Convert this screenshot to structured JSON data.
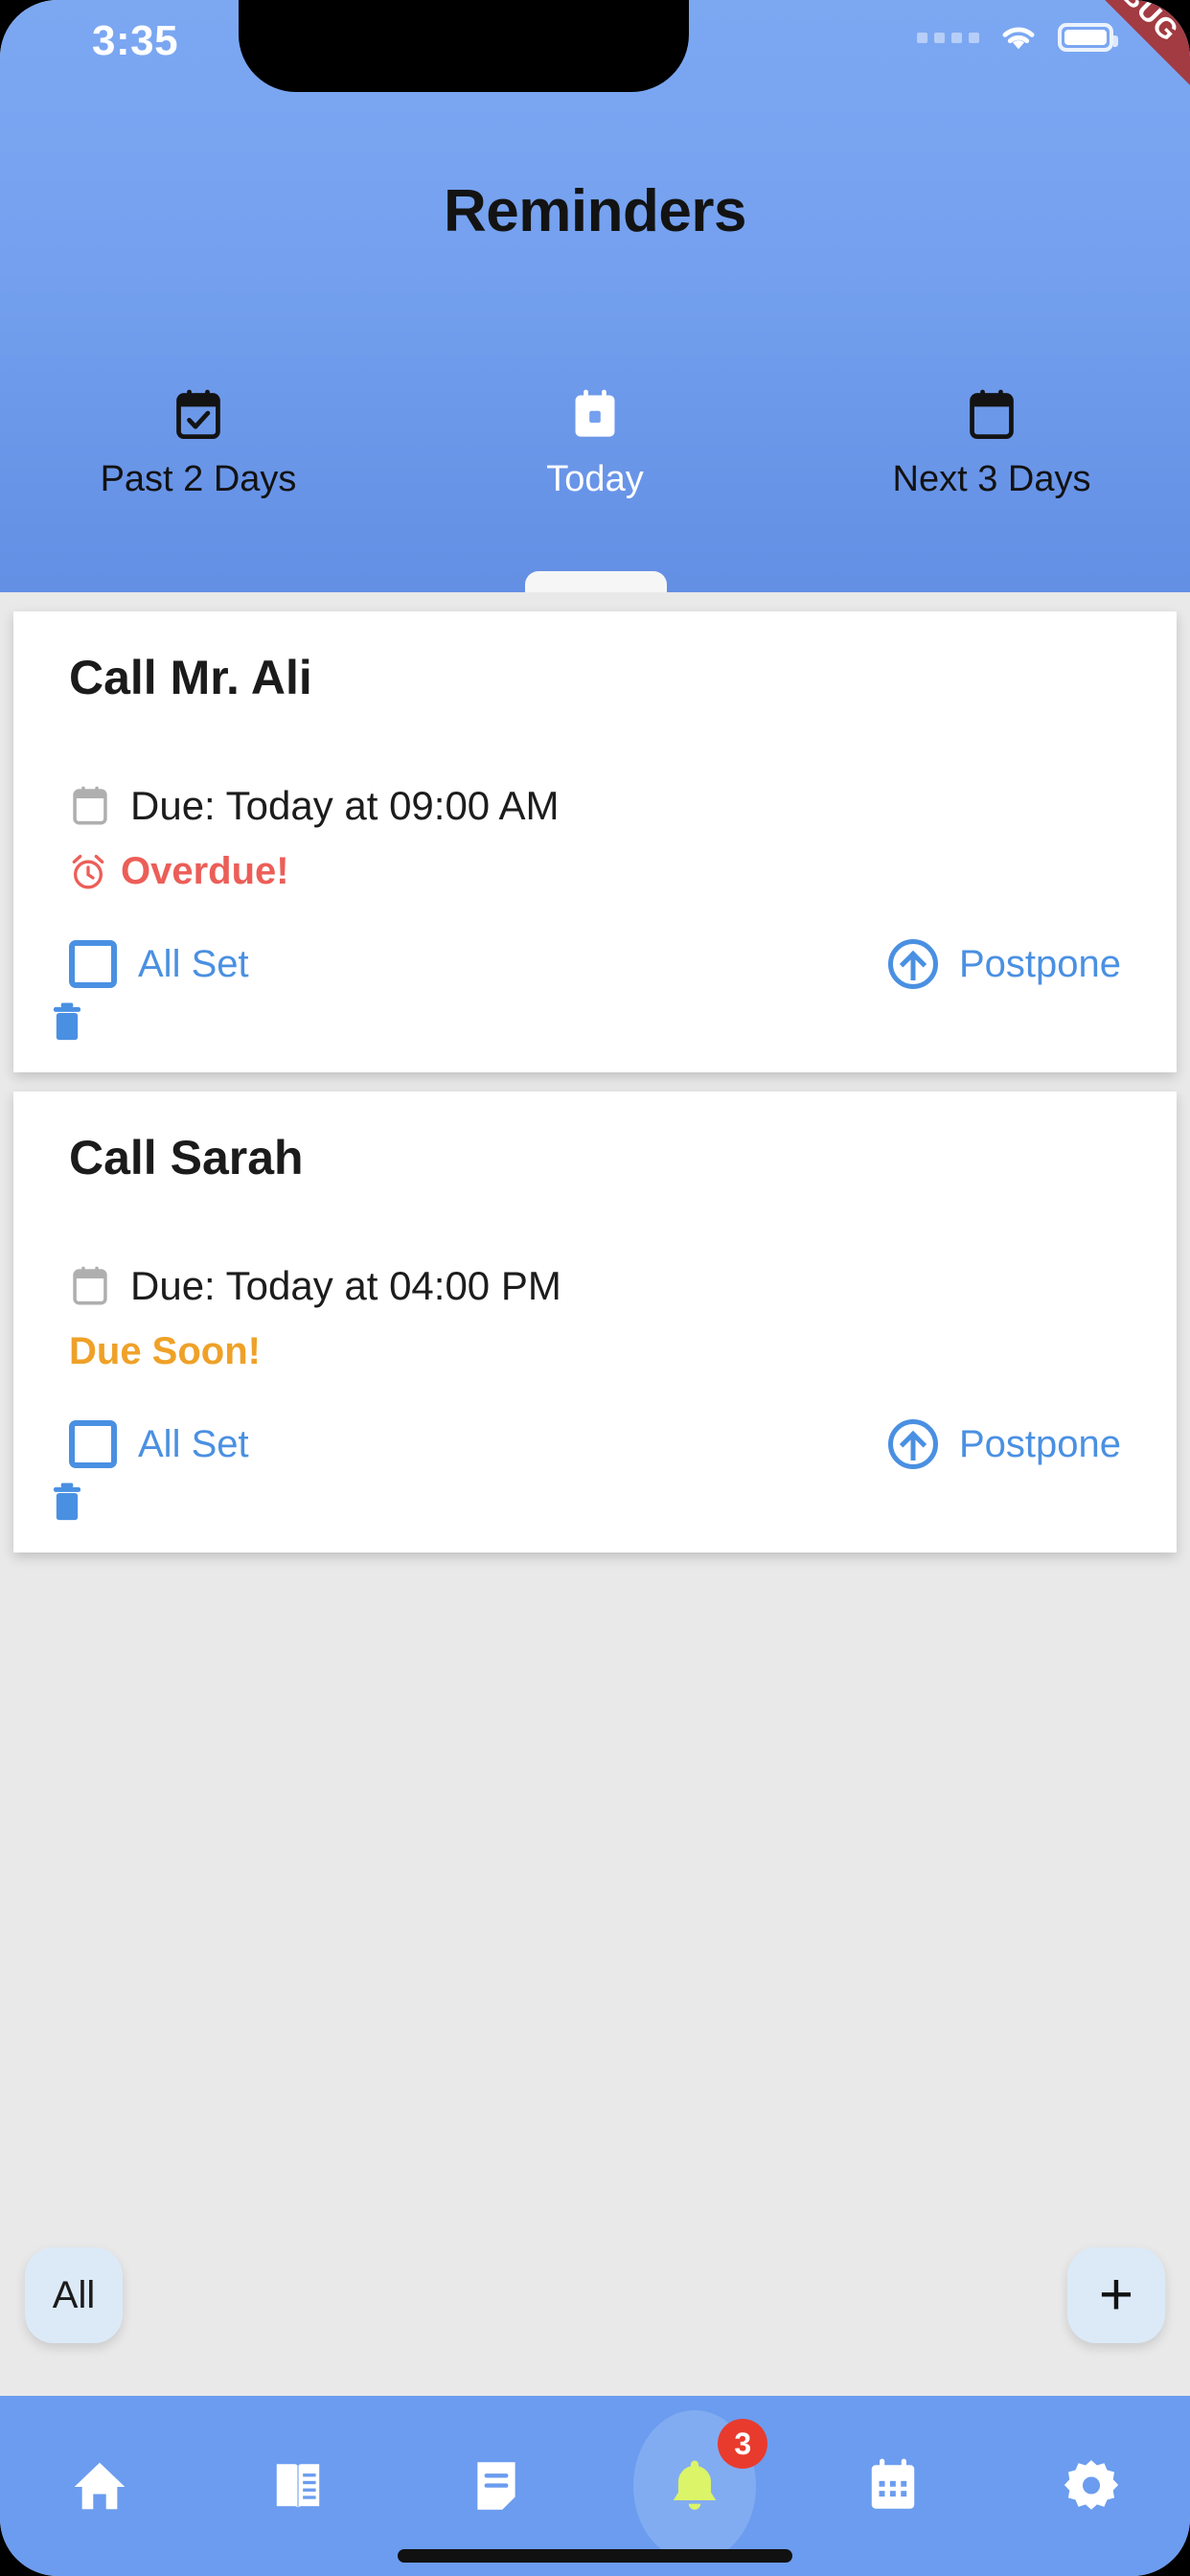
{
  "status_bar": {
    "time": "3:35",
    "signal_icon": "signal-dots-icon",
    "wifi_icon": "wifi-icon",
    "battery_icon": "battery-icon"
  },
  "debug_banner": {
    "label": "DEBUG"
  },
  "header": {
    "title": "Reminders",
    "background_color": "#74A0EF"
  },
  "tabs": [
    {
      "label": "Past 2 Days",
      "icon": "calendar-check-icon",
      "active": false
    },
    {
      "label": "Today",
      "icon": "calendar-today-icon",
      "active": true
    },
    {
      "label": "Next 3 Days",
      "icon": "calendar-blank-icon",
      "active": false
    }
  ],
  "reminders": [
    {
      "title": "Call Mr. Ali",
      "due_text": "Due: Today at 09:00 AM",
      "due_icon": "calendar-icon",
      "status_text": "Overdue!",
      "status_icon": "alarm-clock-icon",
      "status_color": "#EC5E58",
      "complete_label": "All Set",
      "complete_icon": "checkbox-unchecked-icon",
      "postpone_label": "Postpone",
      "postpone_icon": "circle-arrow-up-icon",
      "delete_icon": "trash-icon"
    },
    {
      "title": "Call Sarah",
      "due_text": "Due: Today at 04:00 PM",
      "due_icon": "calendar-icon",
      "status_text": "Due Soon!",
      "status_icon": "",
      "status_color": "#EFA128",
      "complete_label": "All Set",
      "complete_icon": "checkbox-unchecked-icon",
      "postpone_label": "Postpone",
      "postpone_icon": "circle-arrow-up-icon",
      "delete_icon": "trash-icon"
    }
  ],
  "filter_chip": {
    "label": "All"
  },
  "add_button": {
    "label": "+"
  },
  "bottom_nav": {
    "items": [
      {
        "icon": "home-icon",
        "active": false,
        "badge": ""
      },
      {
        "icon": "book-icon",
        "active": false,
        "badge": ""
      },
      {
        "icon": "notes-icon",
        "active": false,
        "badge": ""
      },
      {
        "icon": "bell-icon",
        "active": true,
        "badge": "3"
      },
      {
        "icon": "calendar-icon",
        "active": false,
        "badge": ""
      },
      {
        "icon": "gear-icon",
        "active": false,
        "badge": ""
      }
    ],
    "active_color": "#D4F24C",
    "badge_color": "#E83B2E"
  }
}
